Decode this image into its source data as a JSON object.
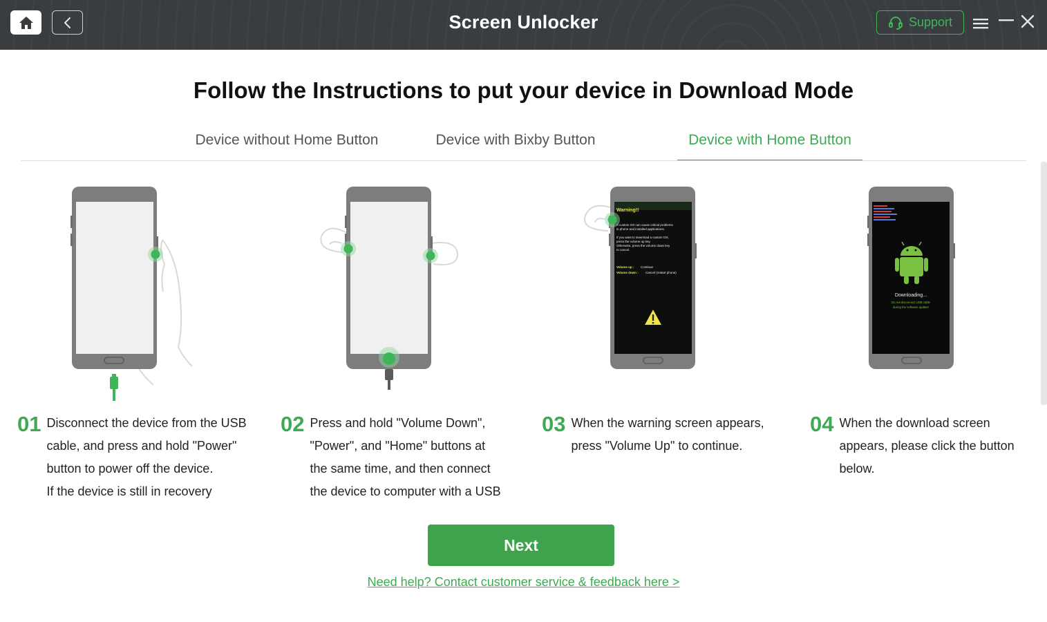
{
  "window": {
    "title": "Screen Unlocker",
    "support_label": "Support"
  },
  "main": {
    "heading": "Follow the Instructions to put your device in Download Mode",
    "tabs": [
      {
        "label": "Device without Home Button",
        "active": false
      },
      {
        "label": "Device with Bixby Button",
        "active": false
      },
      {
        "label": "Device with Home Button",
        "active": true
      }
    ],
    "steps": [
      {
        "num": "01",
        "text": "Disconnect the device from the USB\ncable, and press and hold \"Power\"\nbutton to power off the device.\n If the device is still in recovery"
      },
      {
        "num": "02",
        "text": "Press and hold \"Volume Down\",\n\"Power\", and \"Home\" buttons at\nthe same time, and then connect\nthe device to computer with a USB"
      },
      {
        "num": "03",
        "text": "When the warning screen appears,\npress \"Volume Up\" to continue."
      },
      {
        "num": "04",
        "text": "When the download screen\nappears, please click the button\nbelow."
      }
    ],
    "screen3": {
      "warning_title": "Warning!!",
      "warning_lines": [
        "A custom OS can cause critical problems",
        "in phone and installed applications.",
        "If you want to download a custom OS,",
        "press the volume up key.",
        "Otherwise, press the volume down key",
        "to cancel."
      ],
      "volume_up_key": "Volume up :",
      "volume_up_action": "Continue",
      "volume_down_key": "Volume down :",
      "volume_down_action": "Cancel (restart phone)"
    },
    "screen4": {
      "status": "Downloading...",
      "note_lines": [
        "Do not disconnect USB cable",
        "during the software update!"
      ]
    },
    "next_label": "Next",
    "help_link": "Need help? Contact customer service & feedback here >"
  },
  "colors": {
    "accent": "#3fa955",
    "titlebar": "#3a3d3f",
    "phone_body": "#7d7d7d"
  }
}
